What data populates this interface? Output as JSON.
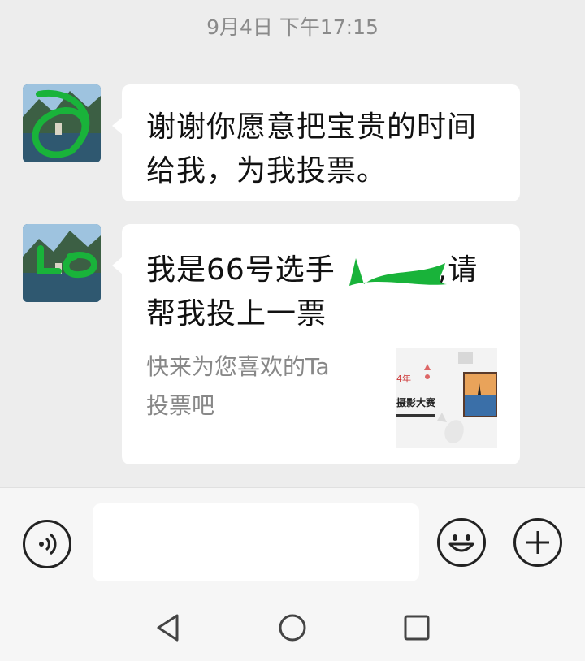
{
  "chat": {
    "timestamp": "9月4日 下午17:15",
    "messages": [
      {
        "sender": "contact",
        "text_line1": "谢谢你愿意把宝贵的时间",
        "text_line2": "给我，为我投票。"
      },
      {
        "sender": "contact",
        "type": "link-card",
        "title_prefix": "我是66号选手",
        "title_suffix": ",请",
        "title_line2": "帮我投上一票",
        "description_line1": "快来为您喜欢的Ta",
        "description_line2": "投票吧",
        "thumbnail_text_top": "4年",
        "thumbnail_text_main": "摄影大赛"
      }
    ]
  },
  "input_bar": {
    "voice_icon": "voice-icon",
    "emoji_icon": "smile-emoji-icon",
    "plus_icon": "plus-icon",
    "placeholder": ""
  },
  "nav_bar": {
    "back_icon": "triangle-back-icon",
    "home_icon": "circle-home-icon",
    "recents_icon": "square-recents-icon"
  },
  "colors": {
    "background": "#ededed",
    "bubble": "#ffffff",
    "redaction_green": "#19b33a"
  }
}
